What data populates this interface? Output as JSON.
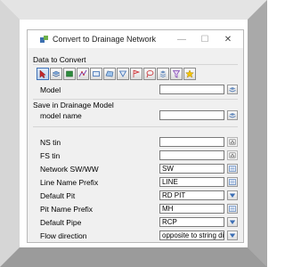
{
  "window": {
    "title": "Convert to Drainage Network",
    "controls": {
      "minimize": "—",
      "maximize": "☐",
      "close": "✕"
    }
  },
  "data_to_convert": {
    "group_title": "Data to Convert",
    "toolbar_icons": [
      "pointer-select-icon",
      "layers-icon",
      "model-icon",
      "string-icon",
      "box-icon",
      "polygon-icon",
      "filter-icon",
      "flag-icon",
      "lasso-icon",
      "stack-icon",
      "funnel-icon",
      "star-icon"
    ],
    "model_label": "Model",
    "model_value": ""
  },
  "save_in_drainage_model": {
    "group_title": "Save in Drainage Model",
    "model_name_label": "model name",
    "model_name_value": ""
  },
  "fields": [
    {
      "label": "NS tin",
      "value": "",
      "button": "tin-pick-icon"
    },
    {
      "label": "FS tin",
      "value": "",
      "button": "tin-pick-icon"
    },
    {
      "label": "Network SW/WW",
      "value": "SW",
      "button": "list-icon"
    },
    {
      "label": "Line Name Prefix",
      "value": "LINE",
      "button": "list-icon"
    },
    {
      "label": "Default Pit",
      "value": "RD PIT",
      "button": "dropdown-icon"
    },
    {
      "label": "Pit Name Prefix",
      "value": "MH",
      "button": "list-icon"
    },
    {
      "label": "Default Pipe",
      "value": "RCP",
      "button": "dropdown-icon"
    },
    {
      "label": "Flow direction",
      "value": "opposite to string direction",
      "button": "dropdown-icon"
    }
  ],
  "colors": {
    "frame": "#c7c7c7",
    "window_bg": "#f0f0f0",
    "accent_blue": "#3d6fb5"
  }
}
